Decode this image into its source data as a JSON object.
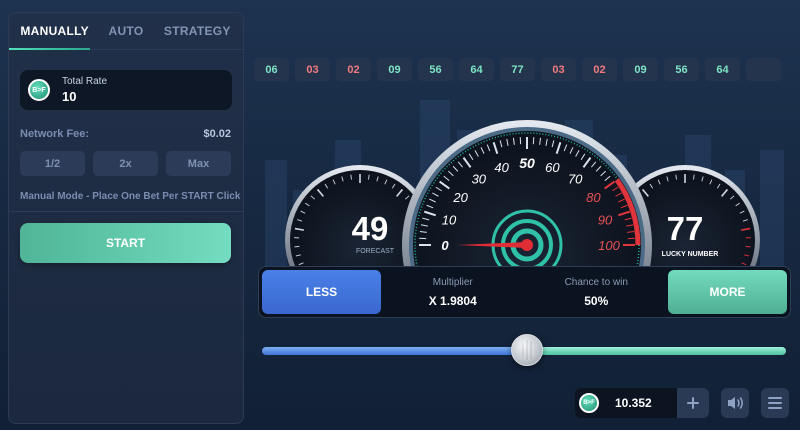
{
  "tabs": [
    {
      "label": "MANUALLY",
      "active": true
    },
    {
      "label": "AUTO",
      "active": false
    },
    {
      "label": "STRATEGY",
      "active": false
    }
  ],
  "currency_icon": "B>F",
  "total_rate": {
    "label": "Total Rate",
    "value": "10"
  },
  "network_fee": {
    "label": "Network Fee:",
    "value": "$0.02"
  },
  "multipliers": [
    "1/2",
    "2x",
    "Max"
  ],
  "manual_note": "Manual Mode - Place One Bet Per START Click",
  "start_label": "START",
  "history": [
    {
      "value": "06",
      "color": "green"
    },
    {
      "value": "03",
      "color": "red"
    },
    {
      "value": "02",
      "color": "red"
    },
    {
      "value": "09",
      "color": "green"
    },
    {
      "value": "56",
      "color": "green"
    },
    {
      "value": "64",
      "color": "green"
    },
    {
      "value": "77",
      "color": "green"
    },
    {
      "value": "03",
      "color": "red"
    },
    {
      "value": "02",
      "color": "red"
    },
    {
      "value": "09",
      "color": "green"
    },
    {
      "value": "56",
      "color": "green"
    },
    {
      "value": "64",
      "color": "green"
    },
    {
      "value": "",
      "color": "empty"
    }
  ],
  "forecast": {
    "value": "49",
    "label": "FORECAST"
  },
  "lucky": {
    "value": "77",
    "label": "LUCKY NUMBER"
  },
  "speedometer": {
    "ticks": [
      "0",
      "10",
      "20",
      "30",
      "40",
      "50",
      "60",
      "70",
      "80",
      "90",
      "100"
    ],
    "needle_value": 0,
    "danger_from": 80
  },
  "less_label": "LESS",
  "more_label": "MORE",
  "multiplier": {
    "label": "Multiplier",
    "value": "X 1.9804"
  },
  "chance": {
    "label": "Chance to win",
    "value": "50%"
  },
  "slider_value": 49,
  "balance": "10.352",
  "colors": {
    "accent_green": "#5cc9aa",
    "accent_blue": "#4a80e8",
    "danger_red": "#e0353d"
  },
  "icons": [
    "sound-icon",
    "menu-icon",
    "plus-icon"
  ]
}
